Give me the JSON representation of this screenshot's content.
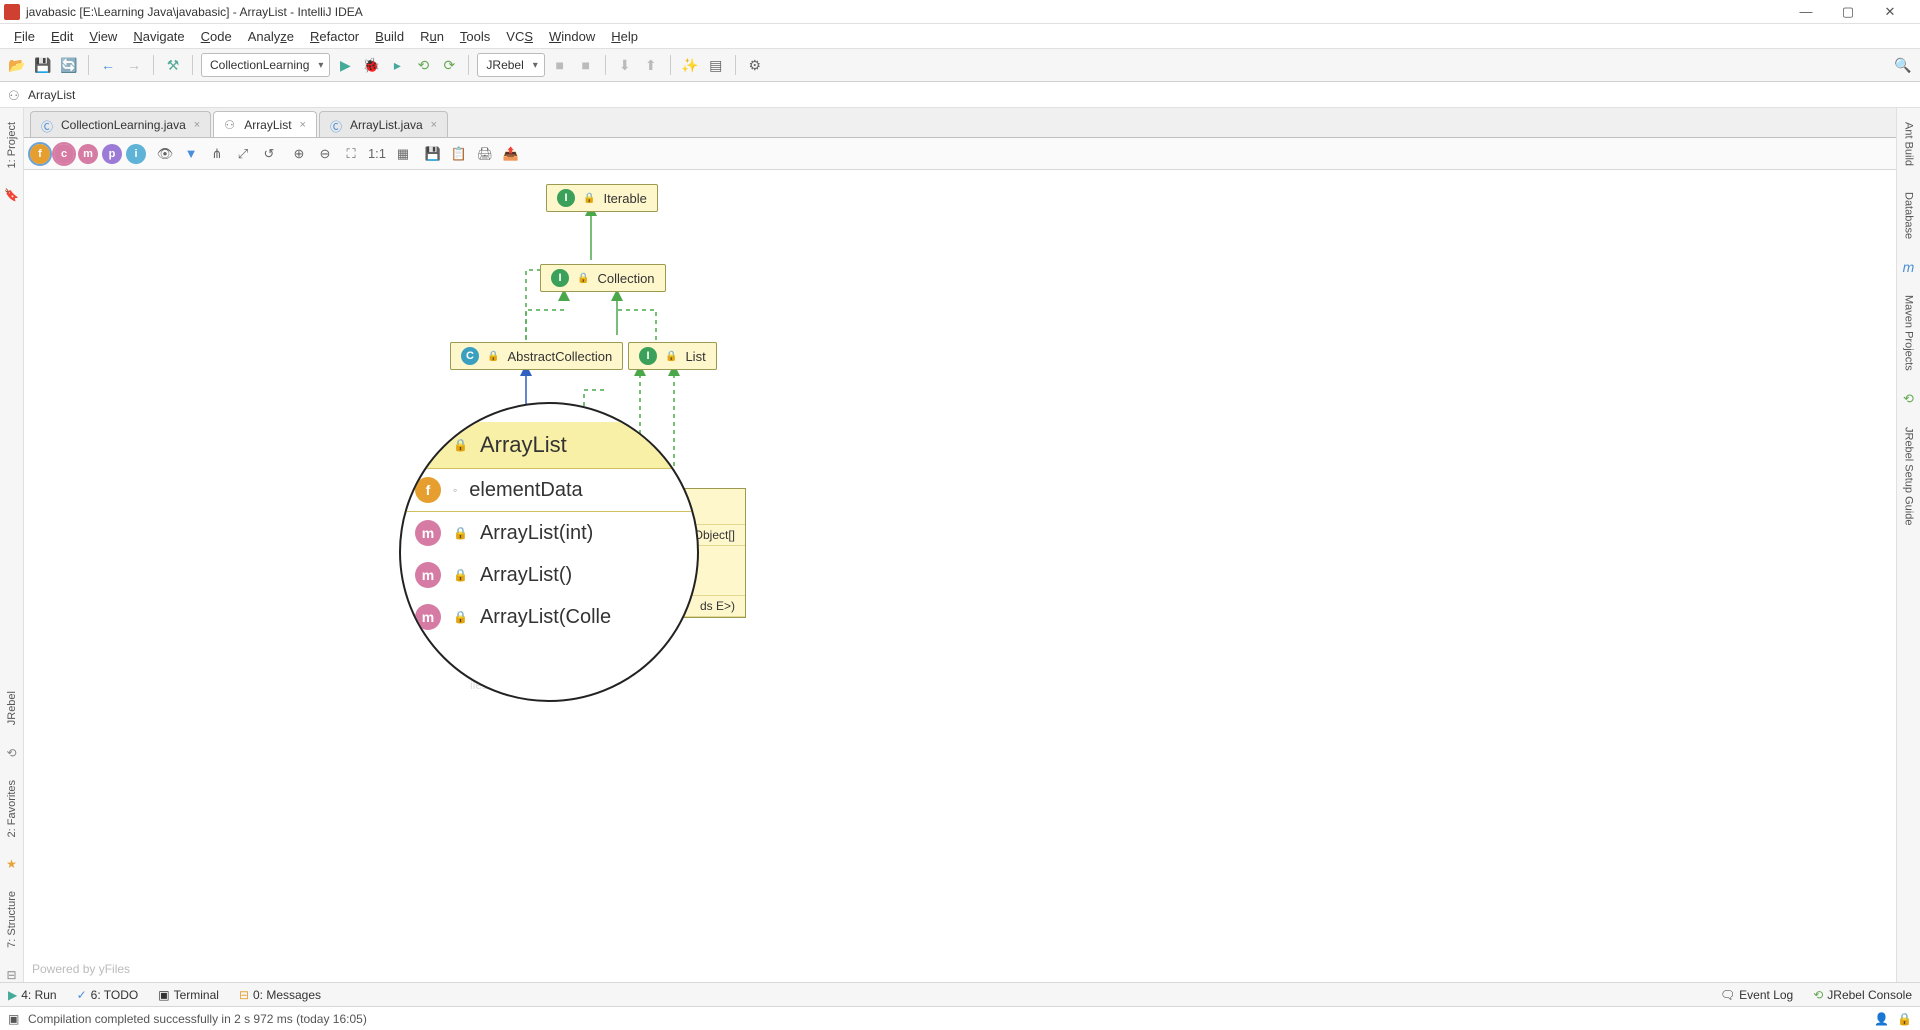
{
  "window": {
    "title": "javabasic [E:\\Learning Java\\javabasic] - ArrayList - IntelliJ IDEA"
  },
  "menu": {
    "file": "File",
    "edit": "Edit",
    "view": "View",
    "navigate": "Navigate",
    "code": "Code",
    "analyze": "Analyze",
    "refactor": "Refactor",
    "build": "Build",
    "run": "Run",
    "tools": "Tools",
    "vcs": "VCS",
    "window": "Window",
    "help": "Help"
  },
  "toolbar": {
    "run_config": "CollectionLearning",
    "jrebel": "JRebel"
  },
  "breadcrumb": {
    "text": "ArrayList"
  },
  "tabs": [
    {
      "label": "CollectionLearning.java",
      "icon": "class",
      "active": false
    },
    {
      "label": "ArrayList",
      "icon": "diagram",
      "active": true
    },
    {
      "label": "ArrayList.java",
      "icon": "class",
      "active": false
    }
  ],
  "left_tabs": {
    "project": "1: Project",
    "jrebel": "JRebel",
    "favorites": "2: Favorites",
    "structure": "7: Structure"
  },
  "right_tabs": {
    "ant": "Ant Build",
    "database": "Database",
    "maven": "Maven Projects",
    "guide": "JRebel Setup Guide"
  },
  "diagram": {
    "nodes": {
      "iterable": "Iterable",
      "collection": "Collection",
      "abstract_collection": "AbstractCollection",
      "list": "List"
    },
    "detail_rows": {
      "r1": "Object[]",
      "r2": "ds E>)"
    },
    "magnified": {
      "title": "ArrayList",
      "rows": [
        {
          "icon": "f",
          "text": "elementData"
        },
        {
          "icon": "m",
          "text": "ArrayList(int)"
        },
        {
          "icon": "m",
          "text": "ArrayList()"
        },
        {
          "icon": "m",
          "text": "ArrayList(Colle"
        }
      ]
    },
    "footer": "Powered by yFiles",
    "obscured_text": "iles"
  },
  "status_tabs": {
    "run": "4: Run",
    "todo": "6: TODO",
    "terminal": "Terminal",
    "messages": "0: Messages",
    "event_log": "Event Log",
    "jrebel_console": "JRebel Console"
  },
  "status_footer": {
    "message": "Compilation completed successfully in 2 s 972 ms (today 16:05)"
  }
}
